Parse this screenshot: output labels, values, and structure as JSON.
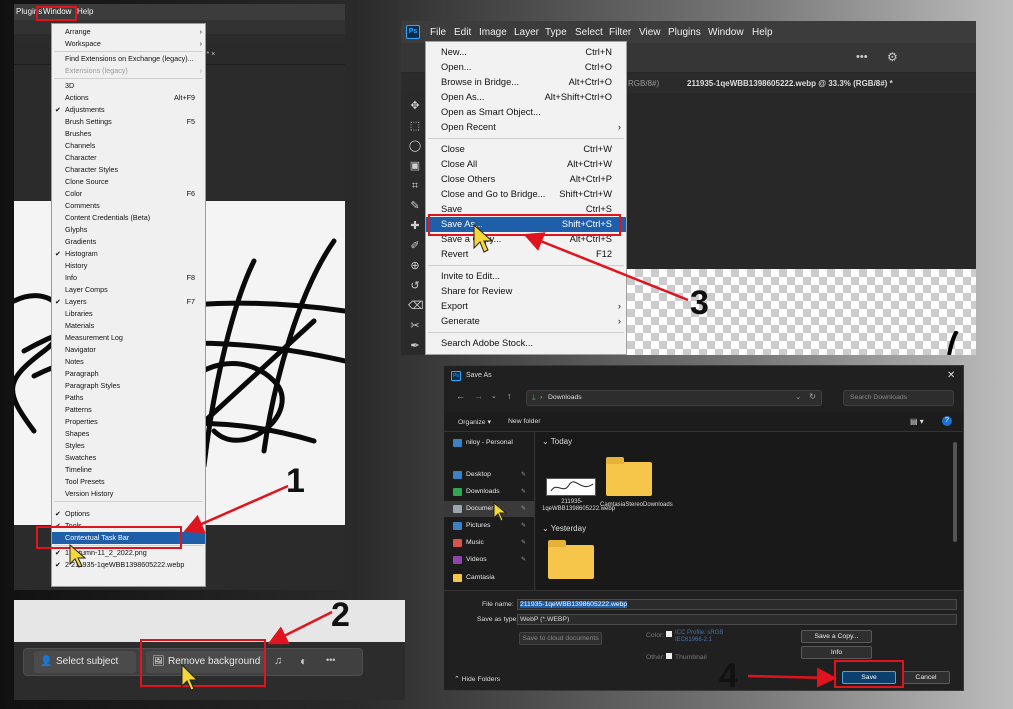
{
  "annotations": {
    "step1": "1",
    "step2": "2",
    "step3": "3",
    "step4": "4",
    "accent_red": "#e0141e"
  },
  "panel1": {
    "menubar": {
      "plugins": "Plugins",
      "window": "Window",
      "help": "Help"
    },
    "tab_close": "(#) * ×",
    "window_menu": {
      "items": [
        {
          "label": "Arrange",
          "arrow": "›"
        },
        {
          "label": "Workspace",
          "arrow": "›"
        },
        {
          "label": "Find Extensions on Exchange (legacy)..."
        },
        {
          "label": "Extensions (legacy)",
          "arrow": "›"
        },
        {
          "label": "3D"
        },
        {
          "label": "Actions",
          "shortcut": "Alt+F9"
        },
        {
          "label": "Adjustments",
          "check": "✔"
        },
        {
          "label": "Brush Settings",
          "shortcut": "F5"
        },
        {
          "label": "Brushes"
        },
        {
          "label": "Channels"
        },
        {
          "label": "Character"
        },
        {
          "label": "Character Styles"
        },
        {
          "label": "Clone Source"
        },
        {
          "label": "Color",
          "shortcut": "F6"
        },
        {
          "label": "Comments"
        },
        {
          "label": "Content Credentials (Beta)"
        },
        {
          "label": "Glyphs"
        },
        {
          "label": "Gradients"
        },
        {
          "label": "Histogram",
          "check": "✔"
        },
        {
          "label": "History"
        },
        {
          "label": "Info",
          "shortcut": "F8"
        },
        {
          "label": "Layer Comps"
        },
        {
          "label": "Layers",
          "shortcut": "F7",
          "check": "✔"
        },
        {
          "label": "Libraries"
        },
        {
          "label": "Materials"
        },
        {
          "label": "Measurement Log"
        },
        {
          "label": "Navigator"
        },
        {
          "label": "Notes"
        },
        {
          "label": "Paragraph"
        },
        {
          "label": "Paragraph Styles"
        },
        {
          "label": "Paths"
        },
        {
          "label": "Patterns"
        },
        {
          "label": "Properties"
        },
        {
          "label": "Shapes"
        },
        {
          "label": "Styles"
        },
        {
          "label": "Swatches"
        },
        {
          "label": "Timeline"
        },
        {
          "label": "Tool Presets"
        },
        {
          "label": "Version History"
        },
        {
          "label": "Options",
          "check": "✔"
        },
        {
          "label": "Tools",
          "check": "✔"
        },
        {
          "label": "Contextual Task Bar"
        },
        {
          "label": "1 autumn-11_2_2022.png",
          "check": "✔"
        },
        {
          "label": "2 211935-1qeWBB1398605222.webp",
          "check": "✔"
        }
      ]
    }
  },
  "panel2": {
    "select_subject": "Select subject",
    "remove_background": "Remove background",
    "more": "•••"
  },
  "panel3": {
    "menubar": [
      "File",
      "Edit",
      "Image",
      "Layer",
      "Type",
      "Select",
      "Filter",
      "View",
      "Plugins",
      "Window",
      "Help"
    ],
    "tab_left": "RGB/8#)",
    "tab_active": "211935-1qeWBB1398605222.webp @ 33.3% (RGB/8#) *",
    "file_menu": {
      "items": [
        {
          "label": "New...",
          "shortcut": "Ctrl+N"
        },
        {
          "label": "Open...",
          "shortcut": "Ctrl+O"
        },
        {
          "label": "Browse in Bridge...",
          "shortcut": "Alt+Ctrl+O"
        },
        {
          "label": "Open As...",
          "shortcut": "Alt+Shift+Ctrl+O"
        },
        {
          "label": "Open as Smart Object..."
        },
        {
          "label": "Open Recent",
          "arrow": "›"
        },
        {
          "label": "Close",
          "shortcut": "Ctrl+W"
        },
        {
          "label": "Close All",
          "shortcut": "Alt+Ctrl+W"
        },
        {
          "label": "Close Others",
          "shortcut": "Alt+Ctrl+P"
        },
        {
          "label": "Close and Go to Bridge...",
          "shortcut": "Shift+Ctrl+W"
        },
        {
          "label": "Save",
          "shortcut": "Ctrl+S"
        },
        {
          "label": "Save As...",
          "shortcut": "Shift+Ctrl+S"
        },
        {
          "label": "Save a Copy...",
          "shortcut": "Alt+Ctrl+S"
        },
        {
          "label": "Revert",
          "shortcut": "F12"
        },
        {
          "label": "Invite to Edit..."
        },
        {
          "label": "Share for Review"
        },
        {
          "label": "Export",
          "arrow": "›"
        },
        {
          "label": "Generate",
          "arrow": "›"
        },
        {
          "label": "Search Adobe Stock..."
        }
      ]
    }
  },
  "panel4": {
    "title": "Save As",
    "breadcrumb": "Downloads",
    "search_placeholder": "Search Downloads",
    "organize": "Organize ▾",
    "new_folder": "New folder",
    "sidebar": [
      {
        "label": "niloy - Personal",
        "color": "#3b82c4"
      },
      {
        "label": "Desktop",
        "color": "#3b82c4"
      },
      {
        "label": "Downloads",
        "color": "#2fa84f"
      },
      {
        "label": "Documents",
        "color": "#9aa4b2"
      },
      {
        "label": "Pictures",
        "color": "#3b82c4"
      },
      {
        "label": "Music",
        "color": "#d9534f"
      },
      {
        "label": "Videos",
        "color": "#8e44ad"
      },
      {
        "label": "Camtasia",
        "color": "#f6c64a"
      }
    ],
    "group_today": "Today",
    "group_yesterday": "Yesterday",
    "files": [
      {
        "label": "211935-1qeWBB1398605222.webp"
      },
      {
        "label": "CamtasiaStereoDownloads"
      }
    ],
    "file_name_label": "File name:",
    "file_name_value": "211935-1qeWBB1398605222.webp",
    "save_type_label": "Save as type:",
    "save_type_value": "WebP (*.WEBP)",
    "save_cloud": "Save to cloud documents",
    "color_label": "Color:",
    "color_profile": "ICC Profile: sRGB IEC61966-2.1",
    "other_label": "Other:",
    "thumbnail": "Thumbnail",
    "save_copy": "Save a Copy...",
    "info": "Info",
    "save": "Save",
    "cancel": "Cancel",
    "hide_folders": "Hide Folders"
  }
}
